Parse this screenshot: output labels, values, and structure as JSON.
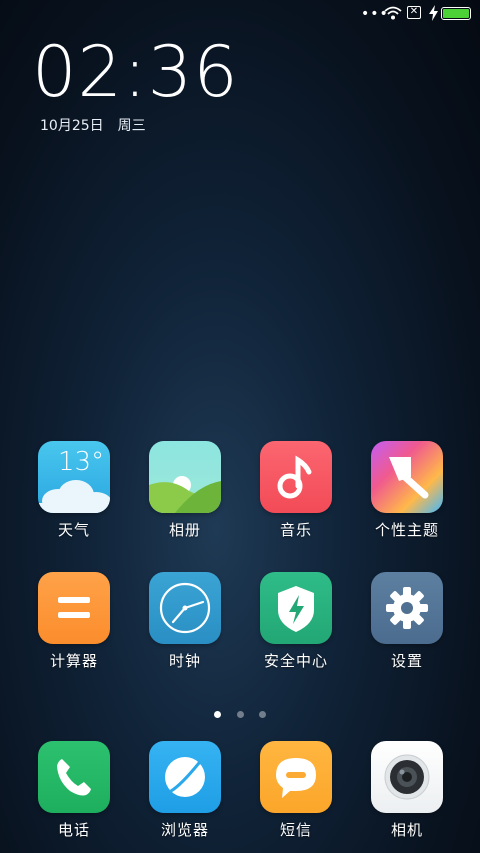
{
  "status_bar": {
    "dots": "•••",
    "sim_glyph": "✕",
    "battery_color": "#4cd137"
  },
  "lock": {
    "time": "02:36",
    "date": "10月25日",
    "weekday": "周三"
  },
  "weather": {
    "temp": "13°"
  },
  "apps": [
    {
      "label": "天气",
      "icon": "weather-icon"
    },
    {
      "label": "相册",
      "icon": "gallery-icon"
    },
    {
      "label": "音乐",
      "icon": "music-icon"
    },
    {
      "label": "个性主题",
      "icon": "themes-icon"
    },
    {
      "label": "计算器",
      "icon": "calculator-icon"
    },
    {
      "label": "时钟",
      "icon": "clock-icon"
    },
    {
      "label": "安全中心",
      "icon": "security-icon"
    },
    {
      "label": "设置",
      "icon": "settings-icon"
    }
  ],
  "dock": [
    {
      "label": "电话",
      "icon": "phone-icon"
    },
    {
      "label": "浏览器",
      "icon": "browser-icon"
    },
    {
      "label": "短信",
      "icon": "messages-icon"
    },
    {
      "label": "相机",
      "icon": "camera-icon"
    }
  ],
  "page_indicator": {
    "count": 3,
    "active": 1
  }
}
